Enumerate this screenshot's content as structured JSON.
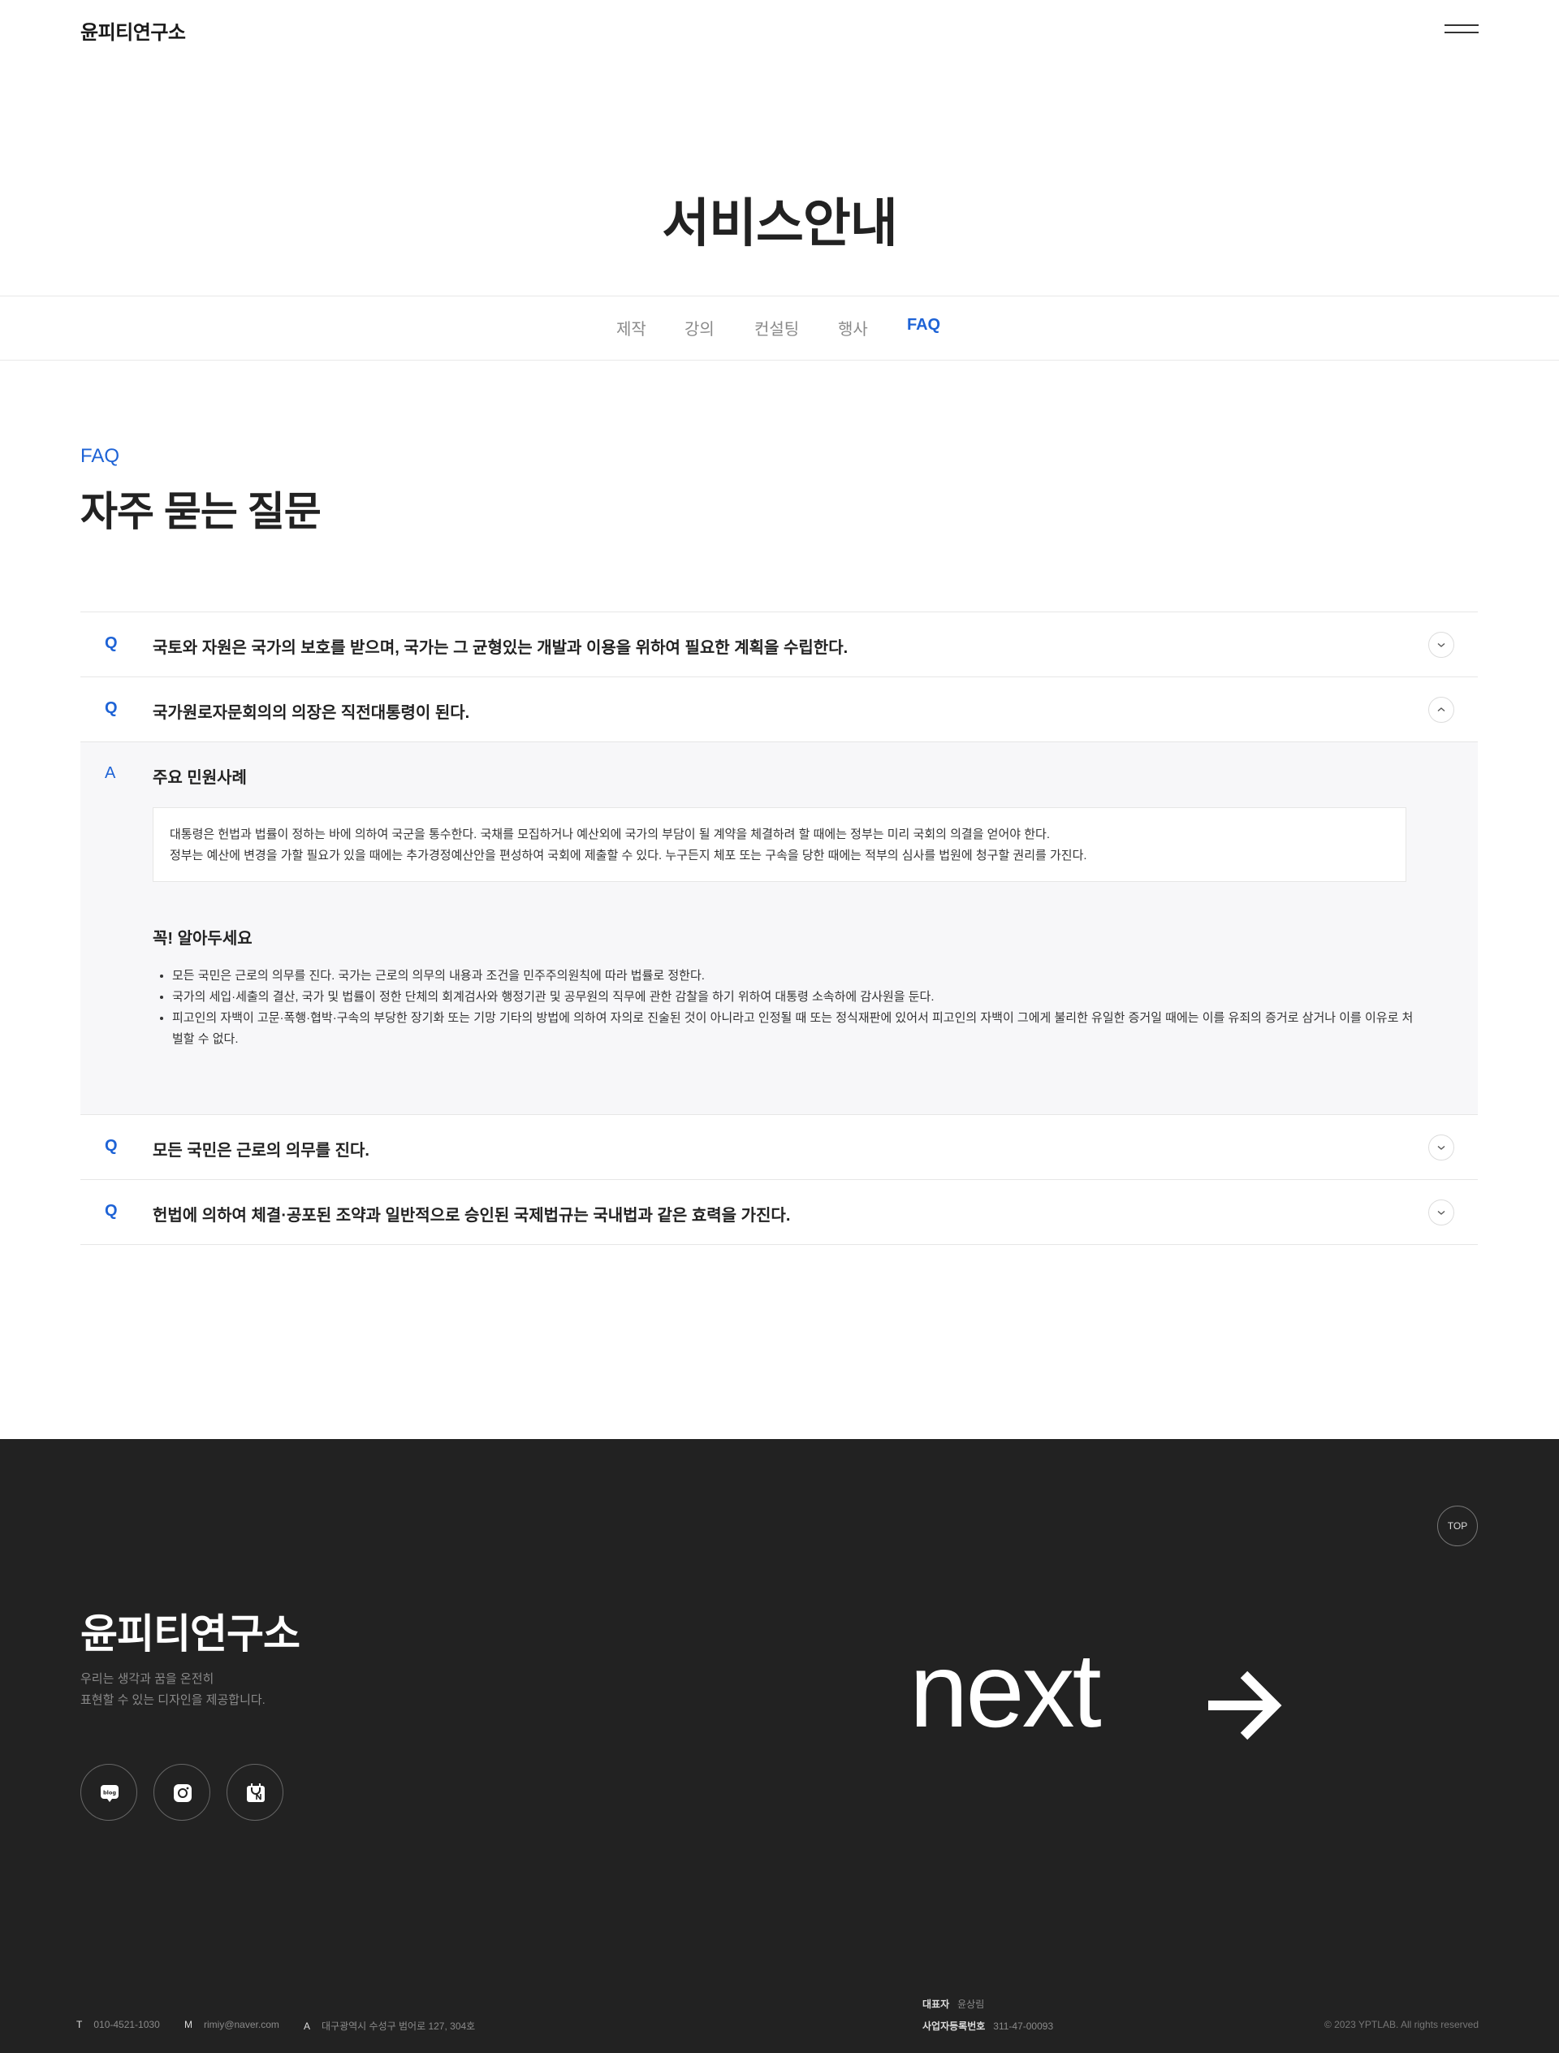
{
  "header": {
    "logo": "윤피티연구소",
    "menu_icon": "hamburger-menu-icon"
  },
  "hero": {
    "title": "서비스안내"
  },
  "tabs": [
    {
      "label": "제작",
      "active": false
    },
    {
      "label": "강의",
      "active": false
    },
    {
      "label": "컨설팅",
      "active": false
    },
    {
      "label": "행사",
      "active": false
    },
    {
      "label": "FAQ",
      "active": true
    }
  ],
  "section": {
    "eyebrow": "FAQ",
    "title": "자주 묻는 질문"
  },
  "faq": {
    "q_marker": "Q",
    "a_marker": "A",
    "items": [
      {
        "question": "국토와 자원은 국가의 보호를 받으며, 국가는 그 균형있는 개발과 이용을 위하여 필요한 계획을 수립한다.",
        "expanded": false
      },
      {
        "question": "국가원로자문회의의 의장은 직전대통령이 된다.",
        "expanded": true
      },
      {
        "question": "모든 국민은 근로의 의무를 진다.",
        "expanded": false
      },
      {
        "question": "헌법에 의하여 체결·공포된 조약과 일반적으로 승인된 국제법규는 국내법과 같은 효력을 가진다.",
        "expanded": false
      }
    ],
    "answer": {
      "title": "주요 민원사례",
      "box_lines": [
        "대통령은 헌법과 법률이 정하는 바에 의하여 국군을 통수한다. 국채를 모집하거나 예산외에 국가의 부담이 될 계약을 체결하려 할 때에는 정부는 미리 국회의 의결을 얻어야 한다.",
        "정부는 예산에 변경을 가할 필요가 있을 때에는 추가경정예산안을 편성하여 국회에 제출할 수 있다. 누구든지 체포 또는 구속을 당한 때에는 적부의 심사를 법원에 청구할 권리를 가진다."
      ],
      "note_title": "꼭! 알아두세요",
      "notes": [
        "모든 국민은 근로의 의무를 진다. 국가는 근로의 의무의 내용과 조건을 민주주의원칙에 따라 법률로 정한다.",
        "국가의 세입·세출의 결산, 국가 및 법률이 정한 단체의 회계검사와 행정기관 및 공무원의 직무에 관한 감찰을 하기 위하여 대통령 소속하에 감사원을 둔다.",
        "피고인의 자백이 고문·폭행·협박·구속의 부당한 장기화 또는 기망 기타의 방법에 의하여 자의로 진술된 것이 아니라고 인정될 때 또는 정식재판에 있어서 피고인의 자백이 그에게 불리한 유일한 증거일 때에는 이를 유죄의 증거로 삼거나 이를 이유로 처벌할 수 없다."
      ]
    }
  },
  "footer": {
    "top_label": "TOP",
    "logo": "윤피티연구소",
    "desc_line1": "우리는 생각과 꿈을 온전히",
    "desc_line2": "표현할 수 있는 디자인을 제공합니다.",
    "social": [
      {
        "icon": "blog-icon"
      },
      {
        "icon": "instagram-icon"
      },
      {
        "icon": "naver-store-icon"
      }
    ],
    "next_label": "next",
    "next_icon": "arrow-right-icon",
    "tel_label": "T",
    "tel": "010-4521-1030",
    "mail_label": "M",
    "mail": "rimiy@naver.com",
    "addr_label": "A",
    "addr": "대구광역시 수성구 범어로 127, 304호",
    "ceo_label": "대표자",
    "ceo": "윤상림",
    "biz_label": "사업자등록번호",
    "biz": "311-47-00093",
    "copyright": "© 2023 YPTLAB. All rights reserved"
  },
  "colors": {
    "accent": "#1e63d6",
    "footer_bg": "#222222",
    "answer_bg": "#f7f7f9"
  }
}
